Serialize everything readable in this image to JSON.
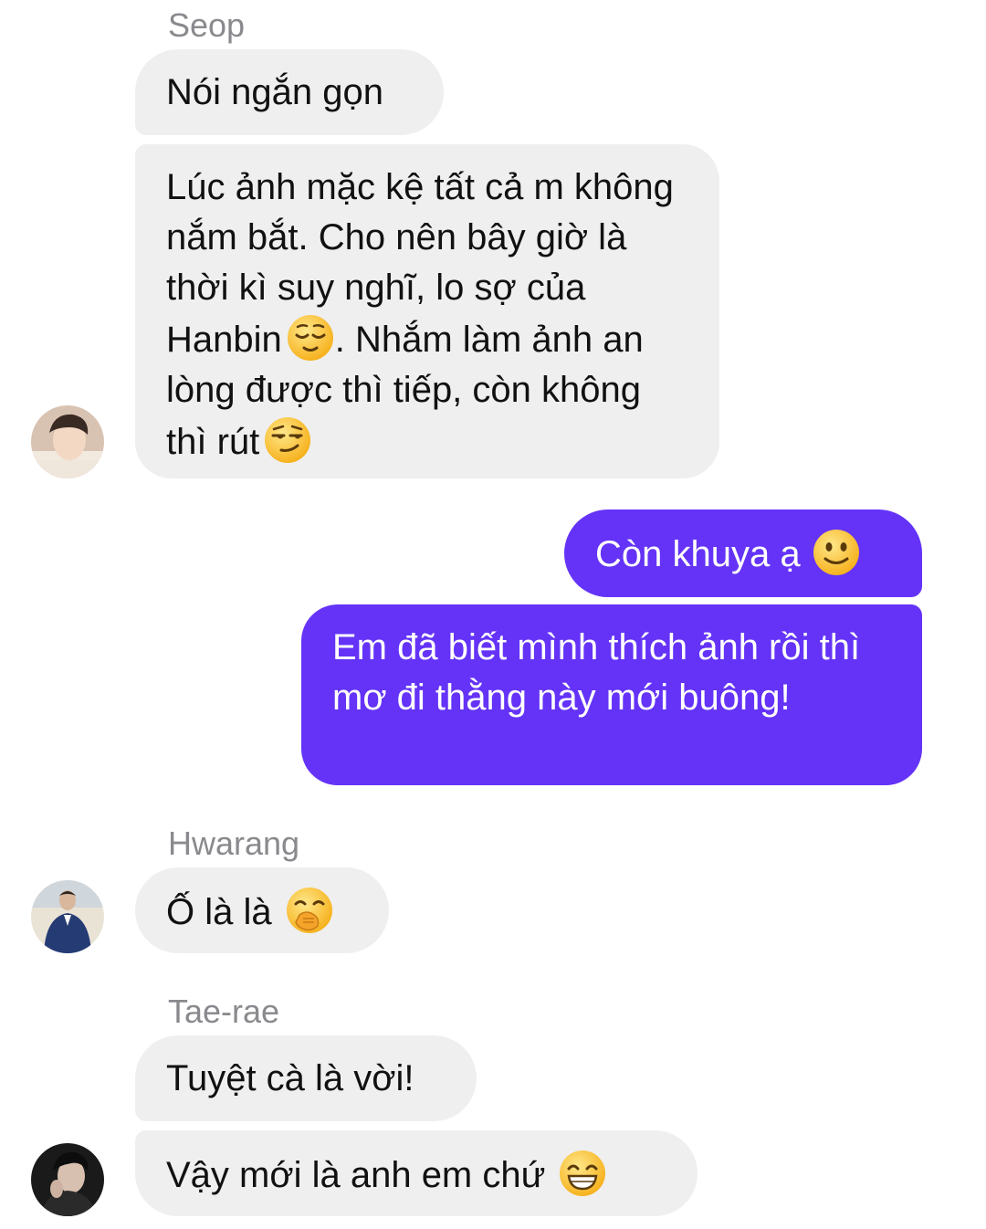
{
  "groups": [
    {
      "sender": "Seop",
      "messages": [
        "Nói ngắn gọn",
        "Lúc ảnh mặc kệ tất cả m không nắm bắt. Cho nên bây giờ là thời kì suy nghĩ, lo sợ của Hanbin",
        ". Nhắm làm ảnh an lòng được thì tiếp, còn không thì rút"
      ],
      "emojis": [
        "relieved-face-emoji",
        "smirking-face-emoji"
      ]
    },
    {
      "sender": "",
      "messages": [
        "Còn khuya ạ",
        "Em đã biết mình thích ảnh rồi thì mơ đi thằng này mới buông!"
      ],
      "emojis": [
        "slightly-smiling-face-emoji"
      ]
    },
    {
      "sender": "Hwarang",
      "messages": [
        "Ố là là"
      ],
      "emojis": [
        "face-with-hand-over-mouth-emoji"
      ]
    },
    {
      "sender": "Tae-rae",
      "messages": [
        "Tuyệt cà là vời!",
        "Vậy mới là anh em chứ"
      ],
      "emojis": [
        "grinning-face-with-smiling-eyes-emoji"
      ]
    }
  ],
  "colors": {
    "incoming_bubble": "#efeff0",
    "outgoing_bubble": "#6433f7",
    "sender_name": "#8a8a8e"
  }
}
